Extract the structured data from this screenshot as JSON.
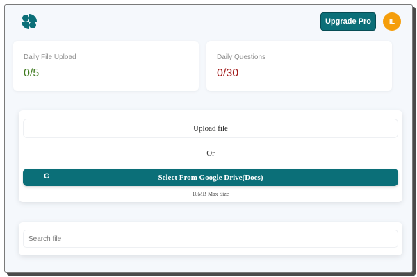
{
  "header": {
    "upgrade_label": "Upgrade Pro",
    "avatar_initials": "IL",
    "logo_icon": "logo-icon",
    "accent_color": "#0b6f78",
    "avatar_color": "#f59e0b"
  },
  "stats": {
    "file_upload": {
      "label": "Daily File Upload",
      "value": "0/5",
      "color": "#3e7a1e"
    },
    "questions": {
      "label": "Daily Questions",
      "value": "0/30",
      "color": "#a01818"
    }
  },
  "upload": {
    "upload_label": "Upload file",
    "or_label": "Or",
    "gdrive_icon_glyph": "G",
    "gdrive_label": "Select From Google Drive(Docs)",
    "max_size": "10MB Max Size"
  },
  "search": {
    "placeholder": "Search file"
  }
}
